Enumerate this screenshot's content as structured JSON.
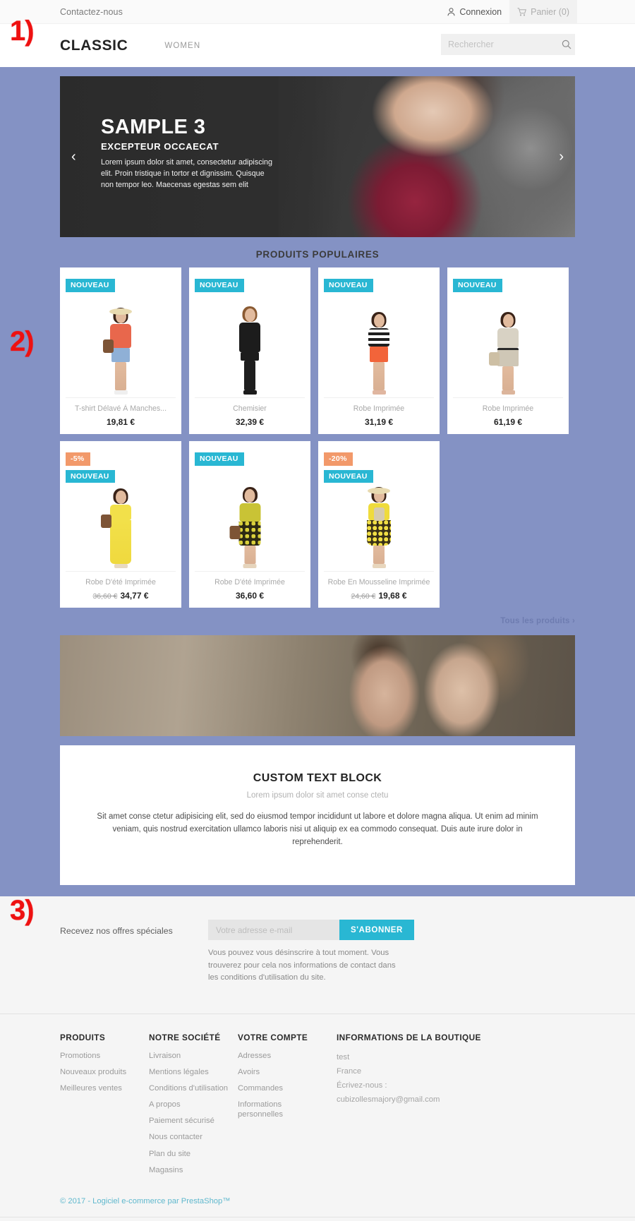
{
  "annotations": {
    "one": "1)",
    "two": "2)",
    "three": "3)"
  },
  "header": {
    "contact": "Contactez-nous",
    "login": "Connexion",
    "cart": "Panier (0)",
    "logo": "CLASSIC",
    "nav_women": "WOMEN",
    "search_placeholder": "Rechercher",
    "search_value": ""
  },
  "hero": {
    "title": "SAMPLE 3",
    "subtitle": "EXCEPTEUR OCCAECAT",
    "description": "Lorem ipsum dolor sit amet, consectetur adipiscing elit. Proin tristique in tortor et dignissim. Quisque non tempor leo. Maecenas egestas sem elit",
    "prev": "‹",
    "next": "›"
  },
  "products": {
    "section_title": "PRODUITS POPULAIRES",
    "all_products_link": "Tous les produits ›",
    "items": [
      {
        "name": "T-shirt Délavé À Manches...",
        "price": "19,81 €",
        "old_price": "",
        "new_badge": "NOUVEAU",
        "discount_badge": ""
      },
      {
        "name": "Chemisier",
        "price": "32,39 €",
        "old_price": "",
        "new_badge": "NOUVEAU",
        "discount_badge": ""
      },
      {
        "name": "Robe Imprimée",
        "price": "31,19 €",
        "old_price": "",
        "new_badge": "NOUVEAU",
        "discount_badge": ""
      },
      {
        "name": "Robe Imprimée",
        "price": "61,19 €",
        "old_price": "",
        "new_badge": "NOUVEAU",
        "discount_badge": ""
      },
      {
        "name": "Robe D'été Imprimée",
        "price": "34,77 €",
        "old_price": "36,60 €",
        "new_badge": "NOUVEAU",
        "discount_badge": "-5%"
      },
      {
        "name": "Robe D'été Imprimée",
        "price": "36,60 €",
        "old_price": "",
        "new_badge": "NOUVEAU",
        "discount_badge": ""
      },
      {
        "name": "Robe En Mousseline Imprimée",
        "price": "19,68 €",
        "old_price": "24,60 €",
        "new_badge": "NOUVEAU",
        "discount_badge": "-20%"
      }
    ]
  },
  "custom_text": {
    "title": "CUSTOM TEXT BLOCK",
    "subtitle": "Lorem ipsum dolor sit amet conse ctetu",
    "body": "Sit amet conse ctetur adipisicing elit, sed do eiusmod tempor incididunt ut labore et dolore magna aliqua. Ut enim ad minim veniam, quis nostrud exercitation ullamco laboris nisi ut aliquip ex ea commodo consequat. Duis aute irure dolor in reprehenderit."
  },
  "newsletter": {
    "label": "Recevez nos offres spéciales",
    "placeholder": "Votre adresse e-mail",
    "value": "",
    "button": "S'ABONNER",
    "note": "Vous pouvez vous désinscrire à tout moment. Vous trouverez pour cela nos informations de contact dans les conditions d'utilisation du site."
  },
  "footer": {
    "col_products": {
      "title": "PRODUITS",
      "links": [
        "Promotions",
        "Nouveaux produits",
        "Meilleures ventes"
      ]
    },
    "col_company": {
      "title": "NOTRE SOCIÉTÉ",
      "links": [
        "Livraison",
        "Mentions légales",
        "Conditions d'utilisation",
        "A propos",
        "Paiement sécurisé",
        "Nous contacter",
        "Plan du site",
        "Magasins"
      ]
    },
    "col_account": {
      "title": "VOTRE COMPTE",
      "links": [
        "Adresses",
        "Avoirs",
        "Commandes",
        "Informations personnelles"
      ]
    },
    "col_shop": {
      "title": "INFORMATIONS DE LA BOUTIQUE",
      "lines": [
        "test",
        "France",
        "Écrivez-nous :",
        "cubizollesmajory@gmail.com"
      ]
    },
    "copyright": "© 2017 - Logiciel e-commerce par PrestaShop™"
  },
  "colors": {
    "page_bg": "#8492c4",
    "accent_cyan": "#29b7d3",
    "discount_orange": "#f2996a",
    "annotation_red": "#ee1111"
  }
}
